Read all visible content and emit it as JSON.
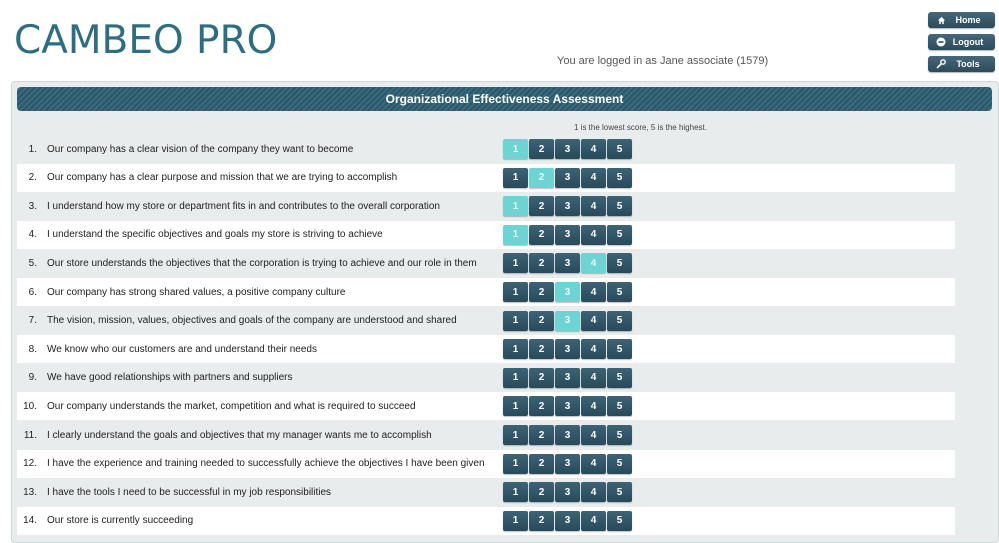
{
  "app": {
    "logo": "CAMBEO PRO"
  },
  "header": {
    "login_text": "You are logged in as Jane associate (1579)"
  },
  "nav": [
    {
      "label": "Home",
      "icon": "home-icon"
    },
    {
      "label": "Logout",
      "icon": "logout-icon"
    },
    {
      "label": "Tools",
      "icon": "wrench-icon"
    }
  ],
  "assessment": {
    "title": "Organizational Effectiveness Assessment",
    "scale_note": "1 is the lowest score, 5 is the highest.",
    "scale": [
      "1",
      "2",
      "3",
      "4",
      "5"
    ],
    "questions": [
      {
        "num": "1.",
        "text": "Our company has a clear vision of the company they want to become",
        "selected": 1
      },
      {
        "num": "2.",
        "text": "Our company has a clear purpose and mission that we are trying to accomplish",
        "selected": 2
      },
      {
        "num": "3.",
        "text": "I understand how my store or department fits in and contributes to the overall corporation",
        "selected": 1
      },
      {
        "num": "4.",
        "text": "I understand the specific objectives and goals my store is striving to achieve",
        "selected": 1
      },
      {
        "num": "5.",
        "text": "Our store understands the objectives that the corporation is trying to achieve and our role in them",
        "selected": 4
      },
      {
        "num": "6.",
        "text": "Our company has strong shared values, a positive company culture",
        "selected": 3
      },
      {
        "num": "7.",
        "text": "The vision, mission, values, objectives and goals of the company are understood and shared",
        "selected": 3
      },
      {
        "num": "8.",
        "text": "We know who our customers are and understand their needs",
        "selected": null
      },
      {
        "num": "9.",
        "text": "We have good relationships with partners and suppliers",
        "selected": null
      },
      {
        "num": "10.",
        "text": "Our company understands the market, competition and what is required to succeed",
        "selected": null
      },
      {
        "num": "11.",
        "text": "I clearly understand the goals and objectives that my manager wants me to accomplish",
        "selected": null
      },
      {
        "num": "12.",
        "text": "I have the experience and training needed to successfully achieve the objectives I have been given",
        "selected": null
      },
      {
        "num": "13.",
        "text": "I have the tools I need to be successful in my job responsibilities",
        "selected": null
      },
      {
        "num": "14.",
        "text": "Our store is currently succeeding",
        "selected": null
      }
    ]
  },
  "colors": {
    "logo": "#2e6e83",
    "button": "#2c4b5c",
    "selected": "#6dd3d3",
    "title_bar": "#2b5769"
  }
}
